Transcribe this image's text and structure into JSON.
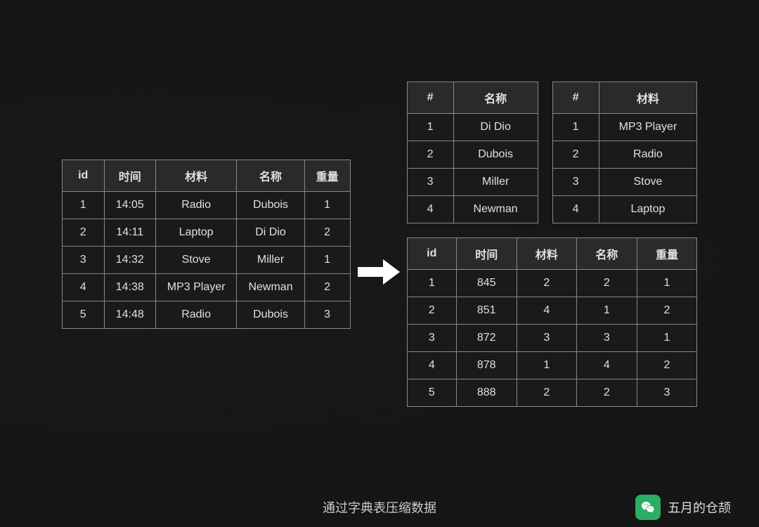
{
  "page": {
    "background": "#1a1a1a"
  },
  "left_table": {
    "headers": [
      "id",
      "时间",
      "材料",
      "名称",
      "重量"
    ],
    "rows": [
      [
        "1",
        "14:05",
        "Radio",
        "Dubois",
        "1"
      ],
      [
        "2",
        "14:11",
        "Laptop",
        "Di Dio",
        "2"
      ],
      [
        "3",
        "14:32",
        "Stove",
        "Miller",
        "1"
      ],
      [
        "4",
        "14:38",
        "MP3\nPlayer",
        "Newman",
        "2"
      ],
      [
        "5",
        "14:48",
        "Radio",
        "Dubois",
        "3"
      ]
    ]
  },
  "top_right_table1": {
    "headers": [
      "#",
      "名称"
    ],
    "rows": [
      [
        "1",
        "Di Dio"
      ],
      [
        "2",
        "Dubois"
      ],
      [
        "3",
        "Miller"
      ],
      [
        "4",
        "Newman"
      ]
    ]
  },
  "top_right_table2": {
    "headers": [
      "#",
      "材料"
    ],
    "rows": [
      [
        "1",
        "MP3\nPlayer"
      ],
      [
        "2",
        "Radio"
      ],
      [
        "3",
        "Stove"
      ],
      [
        "4",
        "Laptop"
      ]
    ]
  },
  "bottom_right_table": {
    "headers": [
      "id",
      "时间",
      "材料",
      "名称",
      "重量"
    ],
    "rows": [
      [
        "1",
        "845",
        "2",
        "2",
        "1"
      ],
      [
        "2",
        "851",
        "4",
        "1",
        "2"
      ],
      [
        "3",
        "872",
        "3",
        "3",
        "1"
      ],
      [
        "4",
        "878",
        "1",
        "4",
        "2"
      ],
      [
        "5",
        "888",
        "2",
        "2",
        "3"
      ]
    ]
  },
  "footer": {
    "text": "通过字典表压缩数据",
    "brand": "五月的仓颉"
  },
  "arrow": {
    "label": "transform arrow"
  }
}
